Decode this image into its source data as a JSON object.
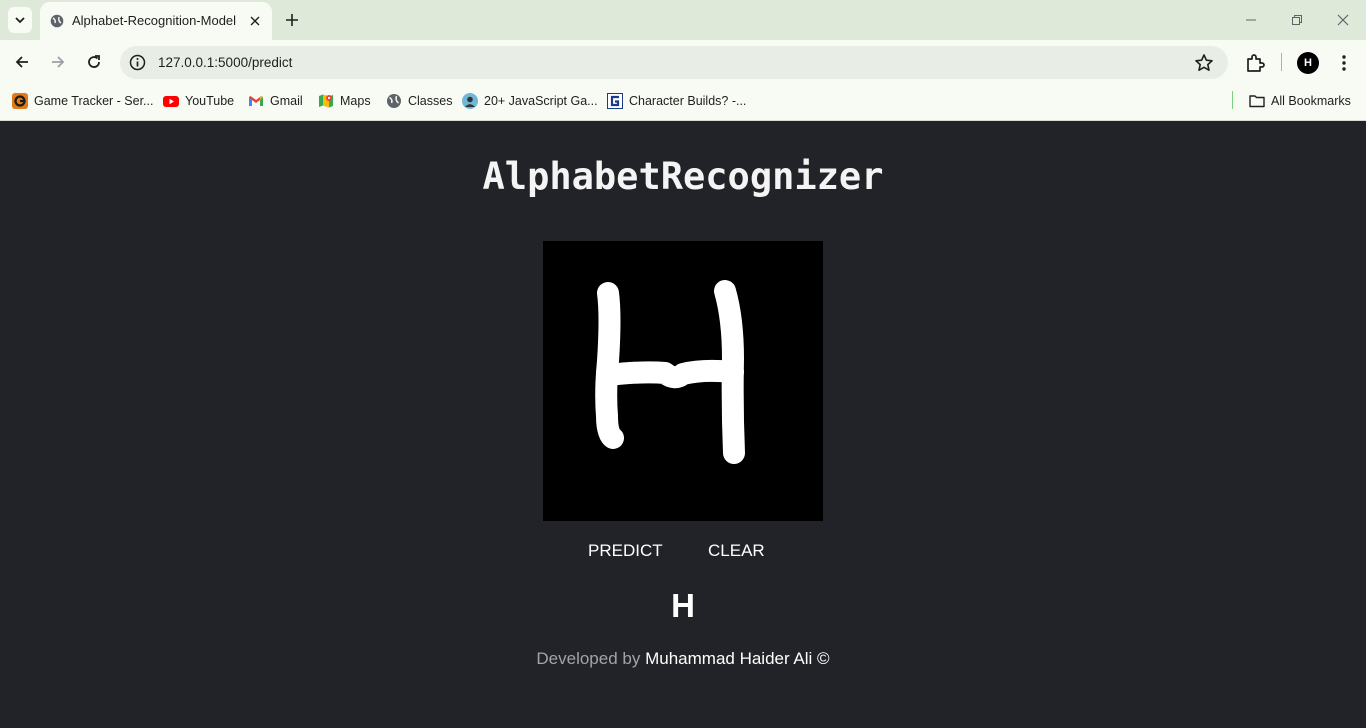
{
  "browser": {
    "tab_title": "Alphabet-Recognition-Model",
    "url": "127.0.0.1:5000/predict",
    "profile_initial": "H",
    "bookmarks": [
      {
        "label": "Game Tracker - Ser...",
        "icon": "game-tracker-icon"
      },
      {
        "label": "YouTube",
        "icon": "youtube-icon"
      },
      {
        "label": "Gmail",
        "icon": "gmail-icon"
      },
      {
        "label": "Maps",
        "icon": "maps-icon"
      },
      {
        "label": "Classes",
        "icon": "globe-icon"
      },
      {
        "label": "20+ JavaScript Ga...",
        "icon": "avatar-icon"
      },
      {
        "label": "Character Builds? -...",
        "icon": "character-builds-icon"
      }
    ],
    "all_bookmarks_label": "All Bookmarks"
  },
  "app": {
    "title": "AlphabetRecognizer",
    "predict_label": "PREDICT",
    "clear_label": "CLEAR",
    "prediction": "H",
    "footer_prefix": "Developed by",
    "footer_author": "Muhammad Haider Ali ©"
  },
  "colors": {
    "page_bg": "#212328",
    "chrome_bg": "#dfe9da",
    "toolbar_bg": "#f7fbf4",
    "canvas_bg": "#000000",
    "stroke": "#ffffff"
  }
}
